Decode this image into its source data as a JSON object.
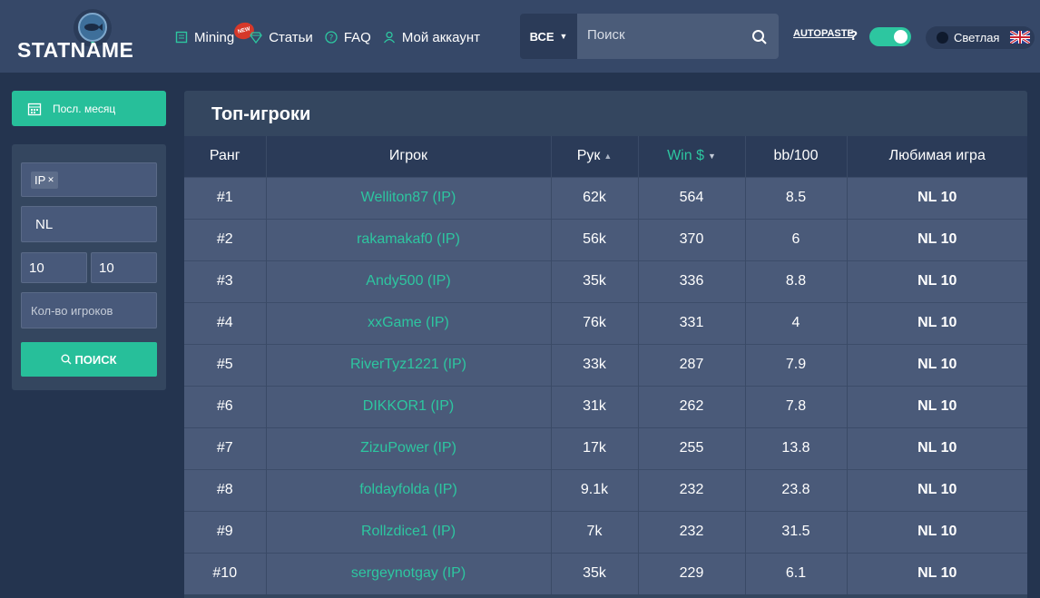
{
  "header": {
    "logo": "STATNAME",
    "nav": [
      {
        "label": "Mining",
        "icon": "book-icon",
        "badge": "NEW"
      },
      {
        "label": "Статьи",
        "icon": "diamond-icon"
      },
      {
        "label": "FAQ",
        "icon": "help-circle-icon"
      },
      {
        "label": "Мой аккаунт",
        "icon": "user-icon"
      }
    ],
    "search": {
      "category": "ВСЕ",
      "placeholder": "Поиск"
    },
    "autopaste": "AUTOPASTE",
    "help": "?",
    "theme_label": "Светлая",
    "accent": "#2dc6a0"
  },
  "sidebar": {
    "period_label": "Посл. месяц",
    "filter": {
      "tag": "IP",
      "limit": "NL",
      "min": "10",
      "max": "10",
      "players_placeholder": "Кол-во игроков",
      "search_label": "ПОИСК"
    }
  },
  "table": {
    "title": "Топ-игроки",
    "columns": [
      "Ранг",
      "Игрок",
      "Рук",
      "Win $",
      "bb/100",
      "Любимая игра"
    ],
    "rows": [
      {
        "rank": "#1",
        "player": "Welliton87 (IP)",
        "hands": "62k",
        "win": "564",
        "bb": "8.5",
        "game": "NL 10"
      },
      {
        "rank": "#2",
        "player": "rakamakaf0 (IP)",
        "hands": "56k",
        "win": "370",
        "bb": "6",
        "game": "NL 10"
      },
      {
        "rank": "#3",
        "player": "Andy500 (IP)",
        "hands": "35k",
        "win": "336",
        "bb": "8.8",
        "game": "NL 10"
      },
      {
        "rank": "#4",
        "player": "xxGame (IP)",
        "hands": "76k",
        "win": "331",
        "bb": "4",
        "game": "NL 10"
      },
      {
        "rank": "#5",
        "player": "RiverTyz1221 (IP)",
        "hands": "33k",
        "win": "287",
        "bb": "7.9",
        "game": "NL 10"
      },
      {
        "rank": "#6",
        "player": "DIKKOR1 (IP)",
        "hands": "31k",
        "win": "262",
        "bb": "7.8",
        "game": "NL 10"
      },
      {
        "rank": "#7",
        "player": "ZizuPower (IP)",
        "hands": "17k",
        "win": "255",
        "bb": "13.8",
        "game": "NL 10"
      },
      {
        "rank": "#8",
        "player": "foldayfolda (IP)",
        "hands": "9.1k",
        "win": "232",
        "bb": "23.8",
        "game": "NL 10"
      },
      {
        "rank": "#9",
        "player": "Rollzdice1 (IP)",
        "hands": "7k",
        "win": "232",
        "bb": "31.5",
        "game": "NL 10"
      },
      {
        "rank": "#10",
        "player": "sergeynotgay (IP)",
        "hands": "35k",
        "win": "229",
        "bb": "6.1",
        "game": "NL 10"
      }
    ]
  }
}
